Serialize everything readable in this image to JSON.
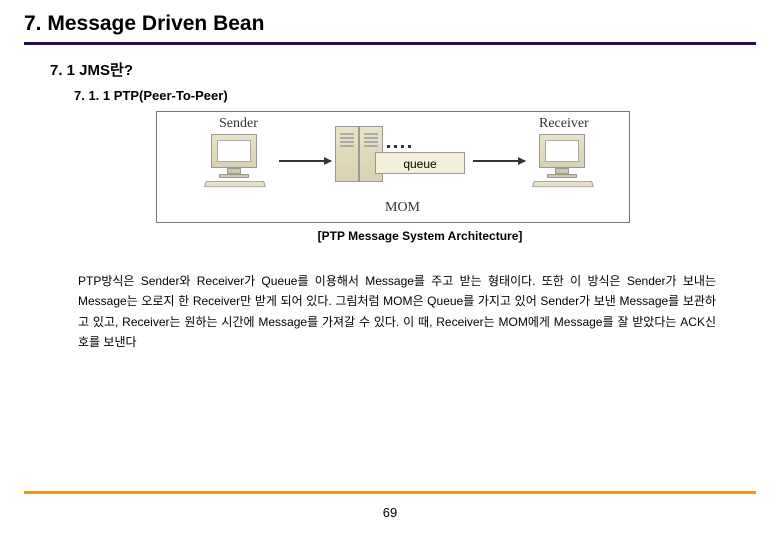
{
  "header": {
    "title": "7. Message Driven Bean"
  },
  "section": {
    "h2": "7. 1 JMS란?",
    "h3": "7. 1. 1 PTP(Peer-To-Peer)"
  },
  "diagram": {
    "sender_label": "Sender",
    "receiver_label": "Receiver",
    "queue_label": "queue",
    "mom_label": "MOM"
  },
  "caption": "[PTP Message System Architecture]",
  "body": "  PTP방식은 Sender와 Receiver가 Queue를 이용해서 Message를 주고 받는 형태이다. 또한 이 방식은 Sender가 보내는 Message는 오로지 한 Receiver만 받게 되어 있다. 그림처럼 MOM은 Queue를 가지고 있어 Sender가 보낸 Message를 보관하고 있고, Receiver는 원하는 시간에 Message를 가져갈 수 있다. 이 때, Receiver는 MOM에게 Message를 잘 받았다는 ACK신호를 보낸다",
  "page_number": "69"
}
